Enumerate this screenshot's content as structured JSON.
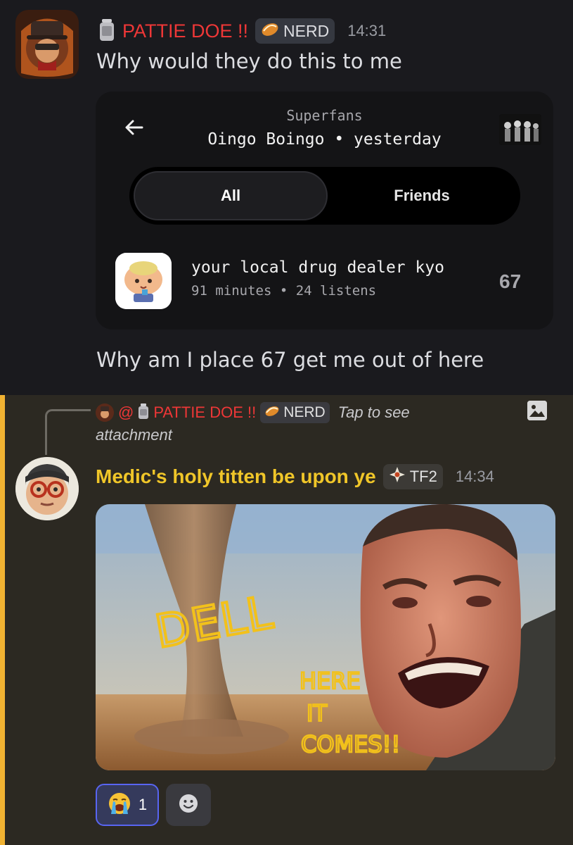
{
  "message1": {
    "username": "PATTIE DOE !!",
    "badge_label": "NERD",
    "timestamp": "14:31",
    "text": "Why would they do this to me",
    "icons": [
      "milk-jug-icon",
      "pastry-badge-icon"
    ]
  },
  "embed": {
    "subtitle": "Superfans",
    "title": "Oingo Boingo • yesterday",
    "tabs": [
      {
        "label": "All",
        "selected": true
      },
      {
        "label": "Friends",
        "selected": false
      }
    ],
    "entry": {
      "name": "your local drug dealer kyo",
      "meta": "91 minutes • 24 listens",
      "rank": "67"
    }
  },
  "message2": {
    "text": "Why am I place 67 get me out of here"
  },
  "reply": {
    "mention": "@",
    "username": "PATTIE DOE !!",
    "badge_label": "NERD",
    "tap_text": "Tap to see",
    "tap_text_2": "attachment"
  },
  "message3": {
    "username": "Medic's holy titten be upon ye",
    "badge_label": "TF2",
    "timestamp": "14:34",
    "image_text": {
      "main": "DELL",
      "line1": "HERE",
      "line2": "IT",
      "line3": "COMES!!"
    }
  },
  "reactions": [
    {
      "emoji": "😭",
      "count": "1"
    }
  ],
  "colors": {
    "background": "#1a1a1e",
    "username_red": "#ee3737",
    "username_gold": "#f0c629",
    "reply_highlight": "#2c2922",
    "reply_bar": "#f0b232",
    "reaction_border": "#5865f2",
    "meme_text": "#f2c11b"
  }
}
